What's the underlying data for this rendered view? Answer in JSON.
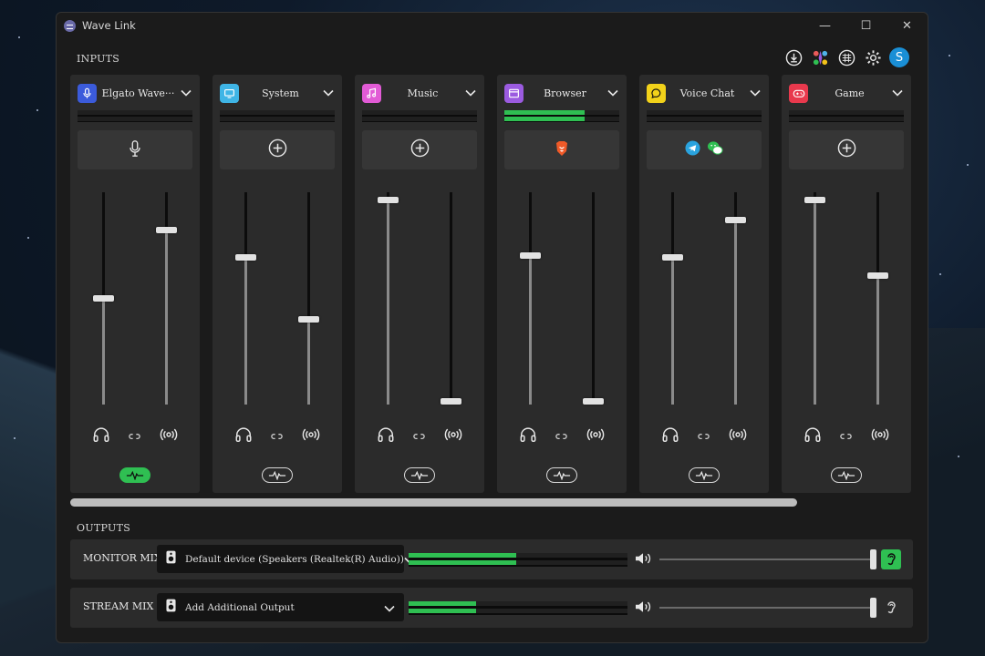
{
  "window": {
    "title": "Wave Link",
    "controls": [
      "—",
      "☐",
      "✕"
    ]
  },
  "inputs_label": "INPUTS",
  "outputs_label": "OUTPUTS",
  "top_icons": [
    "download-icon",
    "marketplace-icon",
    "network-icon",
    "gear-icon"
  ],
  "avatar_letter": "S",
  "colors": {
    "accent_green": "#2fbf52",
    "mic": "#3b5bdb",
    "system": "#3fb5e6",
    "music": "#e25bd6",
    "browser": "#9b5be0",
    "voice": "#f2d21a",
    "game": "#e8394d"
  },
  "channels": [
    {
      "name": "Elgato Wave···",
      "icon": "microphone-icon",
      "color": "#3b5bdb",
      "level": 0,
      "source": "microphone-icon",
      "monitor_volume": 0.5,
      "stream_volume": 0.83,
      "pill_active": true
    },
    {
      "name": "System",
      "icon": "monitor-icon",
      "color": "#3fb5e6",
      "level": 0,
      "source": "add-icon",
      "monitor_volume": 0.7,
      "stream_volume": 0.4,
      "pill_active": false
    },
    {
      "name": "Music",
      "icon": "music-note-icon",
      "color": "#e25bd6",
      "level": 0,
      "source": "add-icon",
      "monitor_volume": 0.98,
      "stream_volume": 0.0,
      "pill_active": false
    },
    {
      "name": "Browser",
      "icon": "browser-window-icon",
      "color": "#9b5be0",
      "level": 0.7,
      "source": "brave-icon",
      "monitor_volume": 0.71,
      "stream_volume": 0.0,
      "pill_active": false
    },
    {
      "name": "Voice Chat",
      "icon": "chat-bubble-icon",
      "color": "#f2d21a",
      "level": 0,
      "source": "telegram-wechat-icons",
      "monitor_volume": 0.7,
      "stream_volume": 0.88,
      "pill_active": false
    },
    {
      "name": "Game",
      "icon": "gamepad-icon",
      "color": "#e8394d",
      "level": 0,
      "source": "add-icon",
      "monitor_volume": 0.98,
      "stream_volume": 0.61,
      "pill_active": false
    }
  ],
  "outputs": [
    {
      "label": "MONITOR MIX",
      "device": "Default device (Speakers (Realtek(R) Audio))",
      "level": 0.49,
      "level2": 0.49,
      "volume": 1.0,
      "ear_active": true
    },
    {
      "label": "STREAM MIX",
      "device": "Add Additional Output",
      "level": 0.31,
      "level2": 0.31,
      "volume": 1.0,
      "ear_active": false
    }
  ]
}
